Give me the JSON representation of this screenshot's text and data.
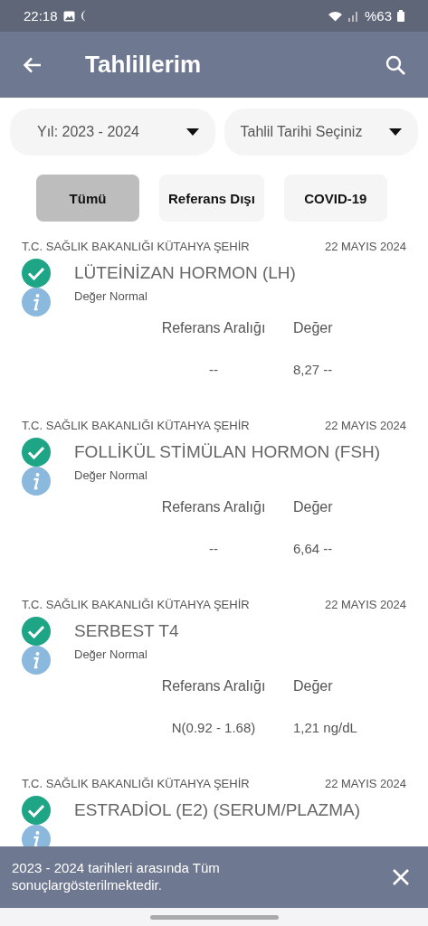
{
  "status_bar": {
    "time": "22:18",
    "battery": "%63"
  },
  "app_bar": {
    "title": "Tahlillerim"
  },
  "filters": [
    {
      "value": "Yıl: 2023 - 2024"
    },
    {
      "value": "Tahlil Tarihi Seçiniz"
    }
  ],
  "chips": [
    {
      "label": "Tümü",
      "selected": true
    },
    {
      "label": "Referans Dışı",
      "selected": false
    },
    {
      "label": "COVID-19",
      "selected": false
    }
  ],
  "results": [
    {
      "institution": "T.C. SAĞLIK BAKANLIĞI KÜTAHYA ŞEHİR",
      "date": "22 MAYIS 2024",
      "test": "LÜTEİNİZAN HORMON (LH)",
      "normal": true,
      "status": "Değer Normal",
      "range_label": "Referans Aralığı",
      "value_label": "Değer",
      "range": "--",
      "value": "8,27 --"
    },
    {
      "institution": "T.C. SAĞLIK BAKANLIĞI KÜTAHYA ŞEHİR",
      "date": "22 MAYIS 2024",
      "test": "FOLLİKÜL STİMÜLAN HORMON (FSH)",
      "normal": true,
      "status": "Değer Normal",
      "range_label": "Referans Aralığı",
      "value_label": "Değer",
      "range": "--",
      "value": "6,64 --"
    },
    {
      "institution": "T.C. SAĞLIK BAKANLIĞI KÜTAHYA ŞEHİR",
      "date": "22 MAYIS 2024",
      "test": "SERBEST T4",
      "normal": true,
      "status": "Değer Normal",
      "range_label": "Referans Aralığı",
      "value_label": "Değer",
      "range": "N(0.92 - 1.68)",
      "value": "1,21 ng/dL"
    },
    {
      "institution": "T.C. SAĞLIK BAKANLIĞI KÜTAHYA ŞEHİR",
      "date": "22 MAYIS 2024",
      "test": "ESTRADİOL (E2) (SERUM/PLAZMA)",
      "normal": true
    }
  ],
  "snackbar": {
    "message": "2023 - 2024 tarihleri arasında Tüm sonuçlargösterilmektedir."
  }
}
